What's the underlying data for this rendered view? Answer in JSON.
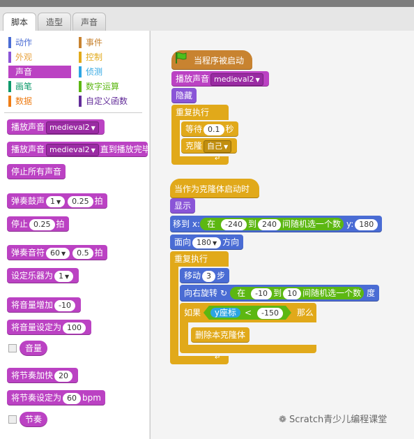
{
  "tabs": [
    "脚本",
    "造型",
    "声音"
  ],
  "categories_left": [
    {
      "label": "动作",
      "color": "#4a6cd4"
    },
    {
      "label": "外观",
      "color": "#8a55d7"
    },
    {
      "label": "声音",
      "color": "#bb42c3",
      "selected": true
    },
    {
      "label": "画笔",
      "color": "#0e9a6c"
    },
    {
      "label": "数据",
      "color": "#ee7d16"
    }
  ],
  "categories_right": [
    {
      "label": "事件",
      "color": "#c88330"
    },
    {
      "label": "控制",
      "color": "#e1a91a"
    },
    {
      "label": "侦测",
      "color": "#2ca5e2"
    },
    {
      "label": "数字运算",
      "color": "#5cb712"
    },
    {
      "label": "自定义函数",
      "color": "#632d99"
    }
  ],
  "palette": {
    "play_sound": "播放声音",
    "sound_name": "medieval2",
    "until_done": "直到播放完毕",
    "stop_all": "停止所有声音",
    "play_drum": "弹奏鼓声",
    "drum_num": "1",
    "drum_beats": "0.25",
    "beats": "拍",
    "rest": "停止",
    "rest_beats": "0.25",
    "play_note": "弹奏音符",
    "note_num": "60",
    "note_beats": "0.5",
    "set_instrument": "设定乐器为",
    "instrument_num": "1",
    "change_volume": "将音量增加",
    "change_volume_val": "-10",
    "set_volume": "将音量设定为",
    "set_volume_val": "100",
    "volume_reporter": "音量",
    "change_tempo": "将节奏加快",
    "change_tempo_val": "20",
    "set_tempo": "将节奏设定为",
    "set_tempo_val": "60",
    "bpm": "bpm",
    "tempo_reporter": "节奏"
  },
  "script1": {
    "hat": "当程序被启动",
    "play_sound": "播放声音",
    "sound_name": "medieval2",
    "hide": "隐藏",
    "forever": "重复执行",
    "wait": "等待",
    "wait_val": "0.1",
    "secs": "秒",
    "clone": "克隆",
    "clone_target": "自己"
  },
  "script2": {
    "hat": "当作为克隆体启动时",
    "show": "显示",
    "goto": "移到 x:",
    "rand_in": "在",
    "x_from": "-240",
    "rand_to": "到",
    "x_to": "240",
    "rand_pick": "间随机选一个数",
    "y_label": "y:",
    "y_val": "180",
    "point": "面向",
    "point_val": "180",
    "direction": "方向",
    "forever": "重复执行",
    "move": "移动",
    "move_val": "3",
    "steps": "步",
    "turn": "向右旋转",
    "turn_from": "-10",
    "turn_to": "10",
    "degrees": "度",
    "if": "如果",
    "ypos": "y座标",
    "lt": "<",
    "lt_val": "-150",
    "then": "那么",
    "delete_clone": "删除本克隆体"
  },
  "watermark": "Scratch青少儿编程课堂"
}
